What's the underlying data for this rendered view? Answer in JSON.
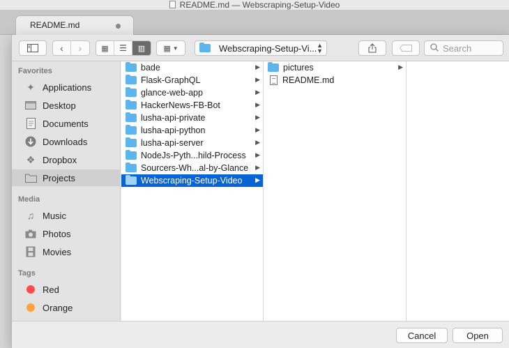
{
  "window": {
    "title": "README.md — Webscraping-Setup-Video",
    "tab_label": "README.md"
  },
  "toolbar": {
    "path_label": "Webscraping-Setup-Vi...",
    "search_placeholder": "Search"
  },
  "sidebar": {
    "favorites_heading": "Favorites",
    "favorites": [
      {
        "label": "Applications",
        "icon": "applications-icon"
      },
      {
        "label": "Desktop",
        "icon": "desktop-icon"
      },
      {
        "label": "Documents",
        "icon": "documents-icon"
      },
      {
        "label": "Downloads",
        "icon": "downloads-icon"
      },
      {
        "label": "Dropbox",
        "icon": "dropbox-icon"
      },
      {
        "label": "Projects",
        "icon": "folder-icon",
        "selected": true
      }
    ],
    "media_heading": "Media",
    "media": [
      {
        "label": "Music",
        "icon": "music-icon"
      },
      {
        "label": "Photos",
        "icon": "photos-icon"
      },
      {
        "label": "Movies",
        "icon": "movies-icon"
      }
    ],
    "tags_heading": "Tags",
    "tags": [
      {
        "label": "Red",
        "color": "#ff4b50"
      },
      {
        "label": "Orange",
        "color": "#ffa33a"
      }
    ]
  },
  "column1": [
    {
      "label": "bade"
    },
    {
      "label": "Flask-GraphQL"
    },
    {
      "label": "glance-web-app"
    },
    {
      "label": "HackerNews-FB-Bot"
    },
    {
      "label": "lusha-api-private"
    },
    {
      "label": "lusha-api-python"
    },
    {
      "label": "lusha-api-server"
    },
    {
      "label": "NodeJs-Pyth...hild-Process"
    },
    {
      "label": "Sourcers-Wh...al-by-Glance"
    },
    {
      "label": "Webscraping-Setup-Video",
      "selected": true
    }
  ],
  "column2": [
    {
      "label": "pictures",
      "type": "folder"
    },
    {
      "label": "README.md",
      "type": "file"
    }
  ],
  "buttons": {
    "cancel": "Cancel",
    "open": "Open"
  },
  "colors": {
    "selection": "#0863d5",
    "folder": "#5cb5ec"
  }
}
